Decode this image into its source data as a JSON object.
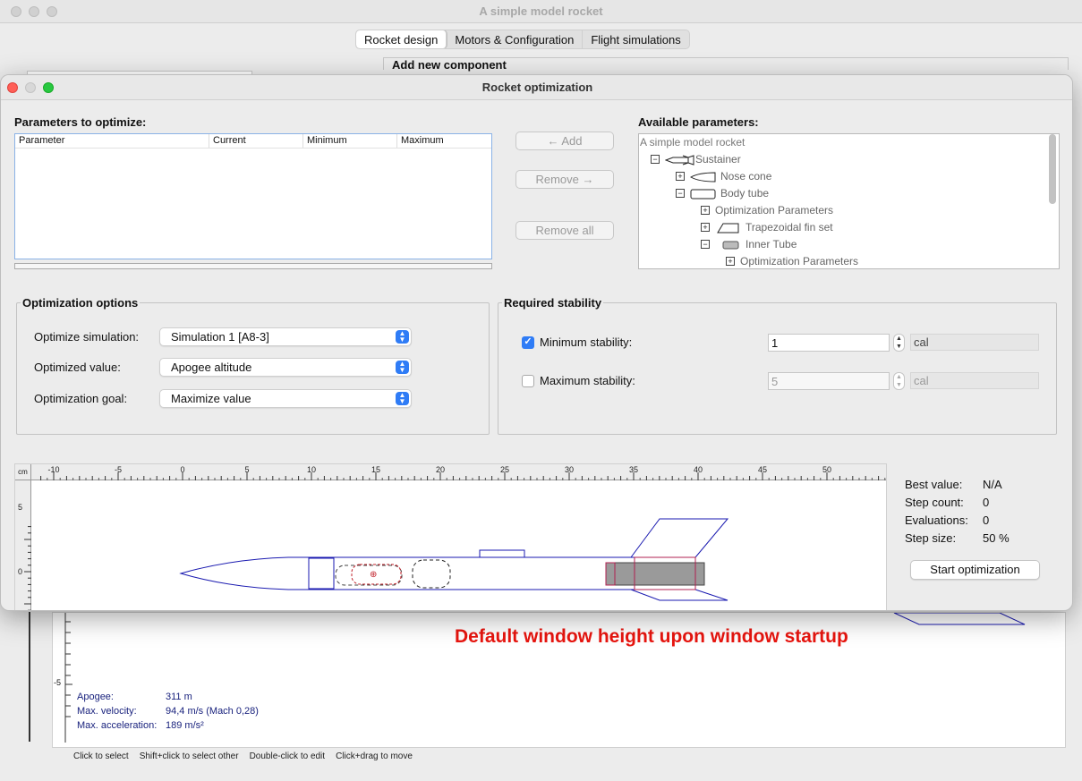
{
  "main_window": {
    "title": "A simple model rocket",
    "tabs": [
      "Rocket design",
      "Motors & Configuration",
      "Flight simulations"
    ],
    "add_component_label": "Add new component",
    "flight_info": {
      "apogee_label": "Apogee:",
      "apogee_value": "311 m",
      "max_velocity_label": "Max. velocity:",
      "max_velocity_value": "94,4 m/s  (Mach 0,28)",
      "max_accel_label": "Max. acceleration:",
      "max_accel_value": "189 m/s²"
    },
    "axis_minus5": "-5",
    "status_hints": [
      "Click to select",
      "Shift+click to select other",
      "Double-click to edit",
      "Click+drag to move"
    ]
  },
  "annotation": "Default window height upon window startup",
  "dialog": {
    "title": "Rocket optimization",
    "params_to_optimize": {
      "title": "Parameters to optimize:",
      "columns": [
        "Parameter",
        "Current",
        "Minimum",
        "Maximum"
      ]
    },
    "buttons": {
      "add": "← Add",
      "remove": "Remove →",
      "remove_all": "Remove all"
    },
    "available": {
      "title": "Available parameters:",
      "tree": [
        {
          "label": "A simple model rocket",
          "expander": "",
          "icon": ""
        },
        {
          "label": "Sustainer",
          "expander": "⊟",
          "icon": "rocket-icon"
        },
        {
          "label": "Nose cone",
          "expander": "⊞",
          "icon": "nose-cone-icon"
        },
        {
          "label": "Body tube",
          "expander": "⊟",
          "icon": "body-tube-icon"
        },
        {
          "label": "Optimization Parameters",
          "expander": "⊞",
          "icon": ""
        },
        {
          "label": "Trapezoidal fin set",
          "expander": "⊞",
          "icon": "fin-set-icon"
        },
        {
          "label": "Inner Tube",
          "expander": "⊟",
          "icon": "inner-tube-icon"
        },
        {
          "label": "Optimization Parameters",
          "expander": "⊞",
          "icon": ""
        }
      ]
    },
    "optimization_options": {
      "title": "Optimization options",
      "simulation_label": "Optimize simulation:",
      "simulation_value": "Simulation 1 [A8-3]",
      "value_label": "Optimized value:",
      "value_value": "Apogee altitude",
      "goal_label": "Optimization goal:",
      "goal_value": "Maximize value"
    },
    "required_stability": {
      "title": "Required stability",
      "min_label": "Minimum stability:",
      "min_checked": true,
      "min_value": "1",
      "min_unit": "cal",
      "max_label": "Maximum stability:",
      "max_checked": false,
      "max_value": "5",
      "max_unit": "cal"
    },
    "figure": {
      "unit": "cm",
      "x_ticks": [
        "-10",
        "-5",
        "0",
        "5",
        "10",
        "15",
        "20",
        "25",
        "30",
        "35",
        "40",
        "45",
        "50"
      ],
      "y_ticks": [
        "5",
        "0"
      ]
    },
    "stats": {
      "best_value_label": "Best value:",
      "best_value": "N/A",
      "step_count_label": "Step count:",
      "step_count": "0",
      "evaluations_label": "Evaluations:",
      "evaluations": "0",
      "step_size_label": "Step size:",
      "step_size": "50 %"
    },
    "start_button": "Start optimization"
  },
  "colors": {
    "rocket_outline": "#1a1ab0",
    "cg_marker": "#c0202a",
    "motor_fill": "#9a9a9a",
    "annotation": "#e8150f"
  }
}
